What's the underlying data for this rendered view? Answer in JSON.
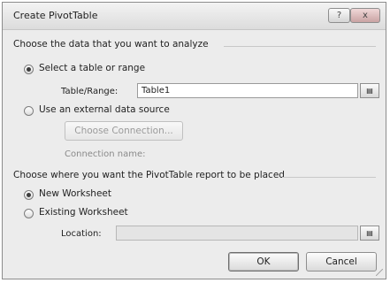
{
  "dialog": {
    "title": "Create PivotTable",
    "help_button": "?",
    "close_button": "x"
  },
  "source_section": {
    "heading": "Choose the data that you want to analyze",
    "option_table": "Select a table or range",
    "table_range_label": "Table/Range:",
    "table_range_value": "Table1",
    "option_external": "Use an external data source",
    "choose_connection_button": "Choose Connection...",
    "connection_name_label": "Connection name:"
  },
  "destination_section": {
    "heading": "Choose where you want the PivotTable report to be placed",
    "option_new": "New Worksheet",
    "option_existing": "Existing Worksheet",
    "location_label": "Location:",
    "location_value": ""
  },
  "footer": {
    "ok_label": "OK",
    "cancel_label": "Cancel"
  }
}
